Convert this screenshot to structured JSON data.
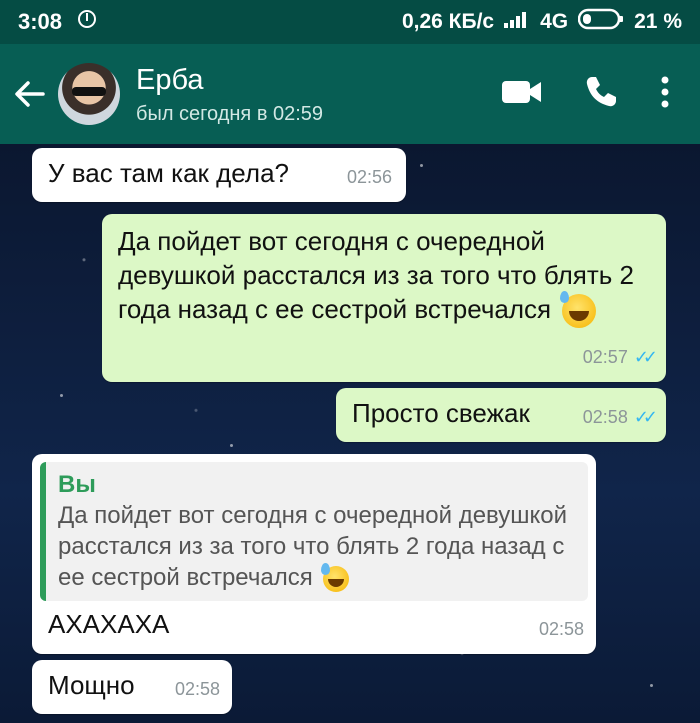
{
  "status_bar": {
    "time": "3:08",
    "network_speed": "0,26 КБ/с",
    "network_type": "4G",
    "battery": "21 %"
  },
  "header": {
    "contact_name": "Ерба",
    "last_seen": "был сегодня в 02:59",
    "icons": [
      "back-arrow-icon",
      "video-call-icon",
      "phone-icon",
      "more-vert-icon"
    ]
  },
  "messages": [
    {
      "direction": "incoming",
      "text": "У вас там как дела?",
      "time": "02:56"
    },
    {
      "direction": "outgoing",
      "text": "Да пойдет вот сегодня с очередной девушкой расстался из за того что блять 2 года назад с ее сестрой встречался",
      "time": "02:57",
      "read": true
    },
    {
      "direction": "outgoing",
      "text": "Просто свежак",
      "time": "02:58",
      "read": true
    },
    {
      "direction": "incoming",
      "quote_author": "Вы",
      "quote_text": "Да пойдет вот сегодня с очередной девушкой расстался из за того что блять 2 года назад с ее сестрой встречался",
      "text": "АХАХАХА",
      "time": "02:58"
    },
    {
      "direction": "incoming",
      "text": "Мощно",
      "time": "02:58"
    }
  ],
  "colors": {
    "header": "#075e54",
    "status_bar": "#054c44",
    "outgoing_bubble": "#dcf8c6",
    "incoming_bubble": "#ffffff",
    "read_ticks": "#34b7f1",
    "quote_accent": "#2e9c5a"
  }
}
